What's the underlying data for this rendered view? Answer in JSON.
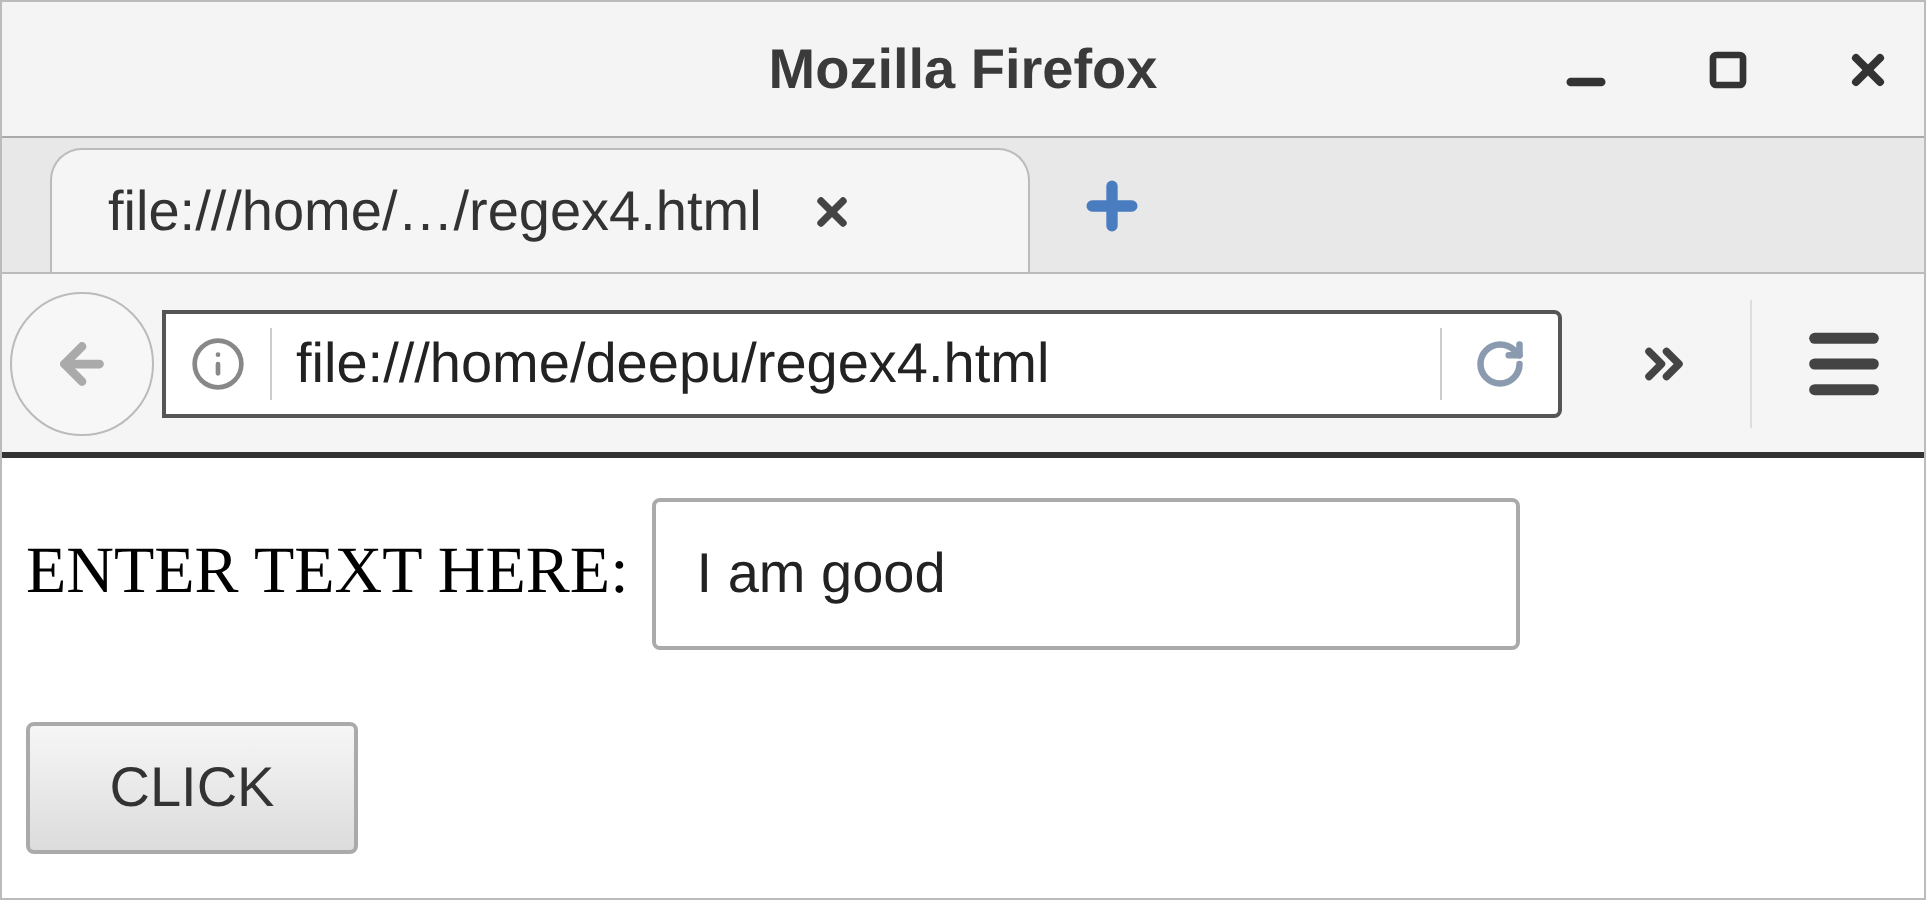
{
  "window": {
    "title": "Mozilla Firefox"
  },
  "tabs": [
    {
      "label": "file:///home/…/regex4.html",
      "selected": true
    }
  ],
  "address_bar": {
    "url": "file:///home/deepu/regex4.html"
  },
  "page": {
    "label": "ENTER TEXT HERE:",
    "input_value": "I am good",
    "button": "CLICK"
  }
}
